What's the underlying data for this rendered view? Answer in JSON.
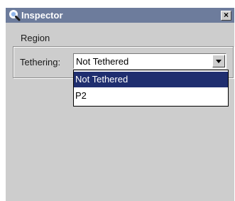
{
  "window": {
    "title": "Inspector",
    "close_label": "×",
    "title_icon": "magnifier-icon"
  },
  "region": {
    "legend": "Region",
    "tethering_label": "Tethering:",
    "tethering_value": "Not Tethered",
    "options": [
      "Not Tethered",
      "P2"
    ],
    "selected_option": "Not Tethered"
  },
  "colors": {
    "titlebar": "#6d7c9c",
    "selection": "#1f2e6f",
    "panel": "#cdcdcd"
  }
}
